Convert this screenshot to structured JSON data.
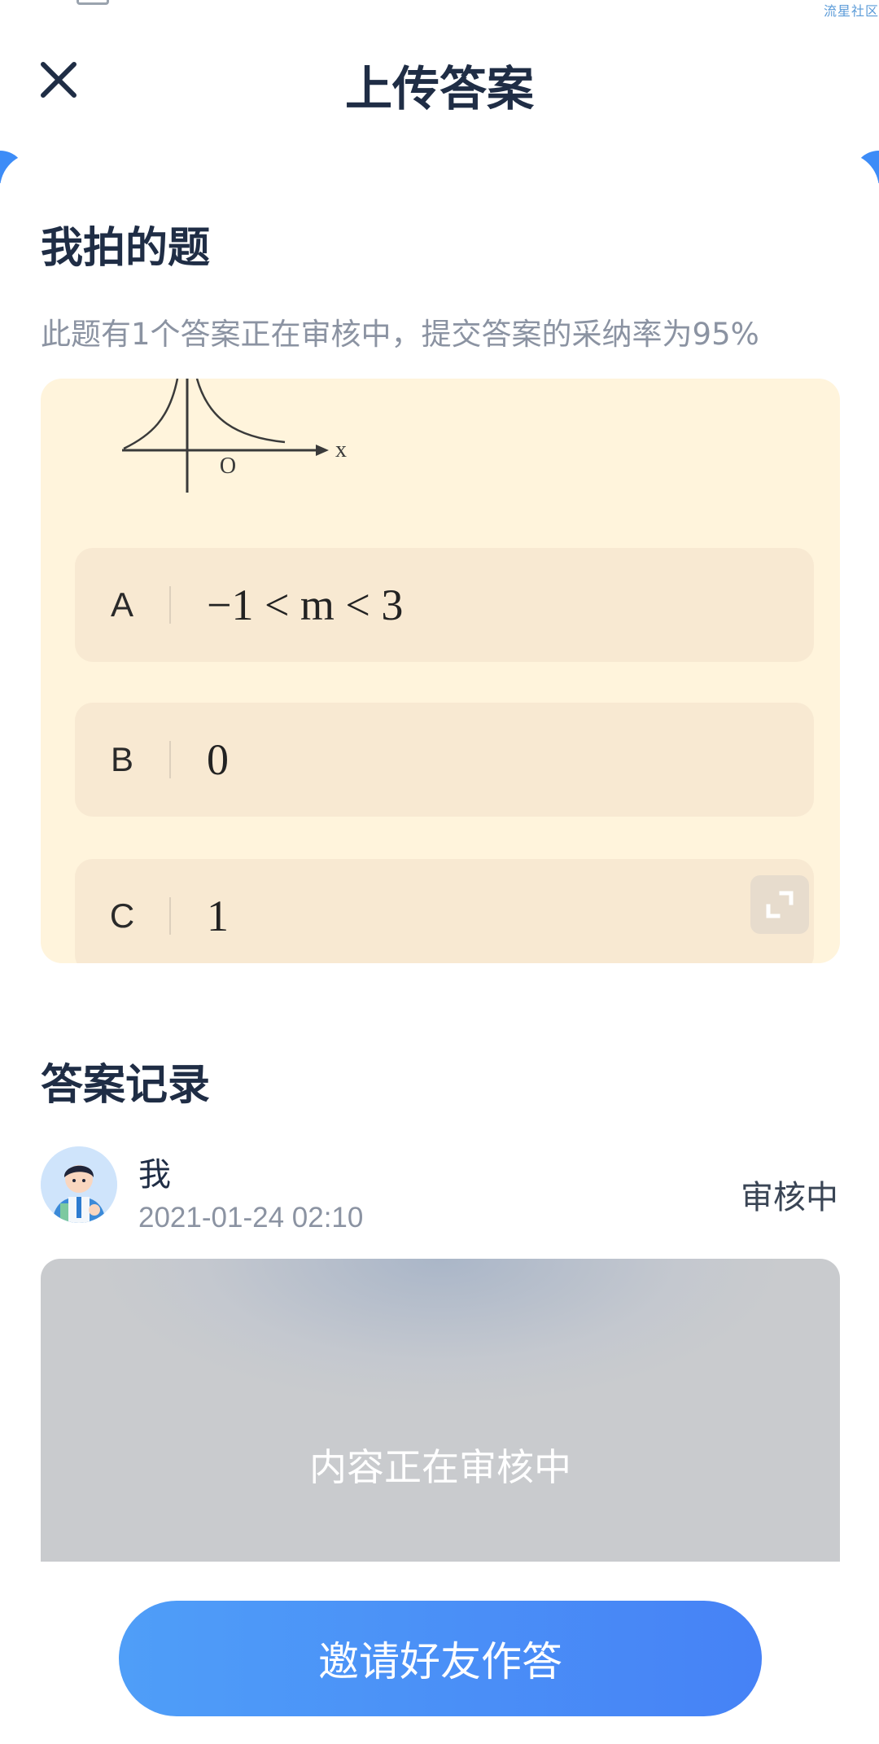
{
  "header": {
    "title": "上传答案",
    "watermark": "流星社区"
  },
  "question_section": {
    "title": "我拍的题",
    "notice": "此题有1个答案正在审核中，提交答案的采纳率为95%",
    "graph_labels": {
      "x_axis": "x",
      "origin": "O"
    },
    "options": [
      {
        "letter": "A",
        "content": "−1 < m < 3"
      },
      {
        "letter": "B",
        "content": "0"
      },
      {
        "letter": "C",
        "content": "1"
      }
    ]
  },
  "answer_section": {
    "title": "答案记录",
    "record": {
      "name": "我",
      "time": "2021-01-24 02:10",
      "status": "审核中",
      "content_placeholder": "内容正在审核中"
    }
  },
  "footer": {
    "invite_label": "邀请好友作答"
  },
  "colors": {
    "primary": "#4682f6",
    "title": "#1f2d45",
    "muted": "#8b93a2",
    "question_bg": "#fff4dc",
    "option_bg": "#f8e9d2"
  },
  "icons": [
    "close-icon",
    "expand-icon",
    "avatar"
  ]
}
